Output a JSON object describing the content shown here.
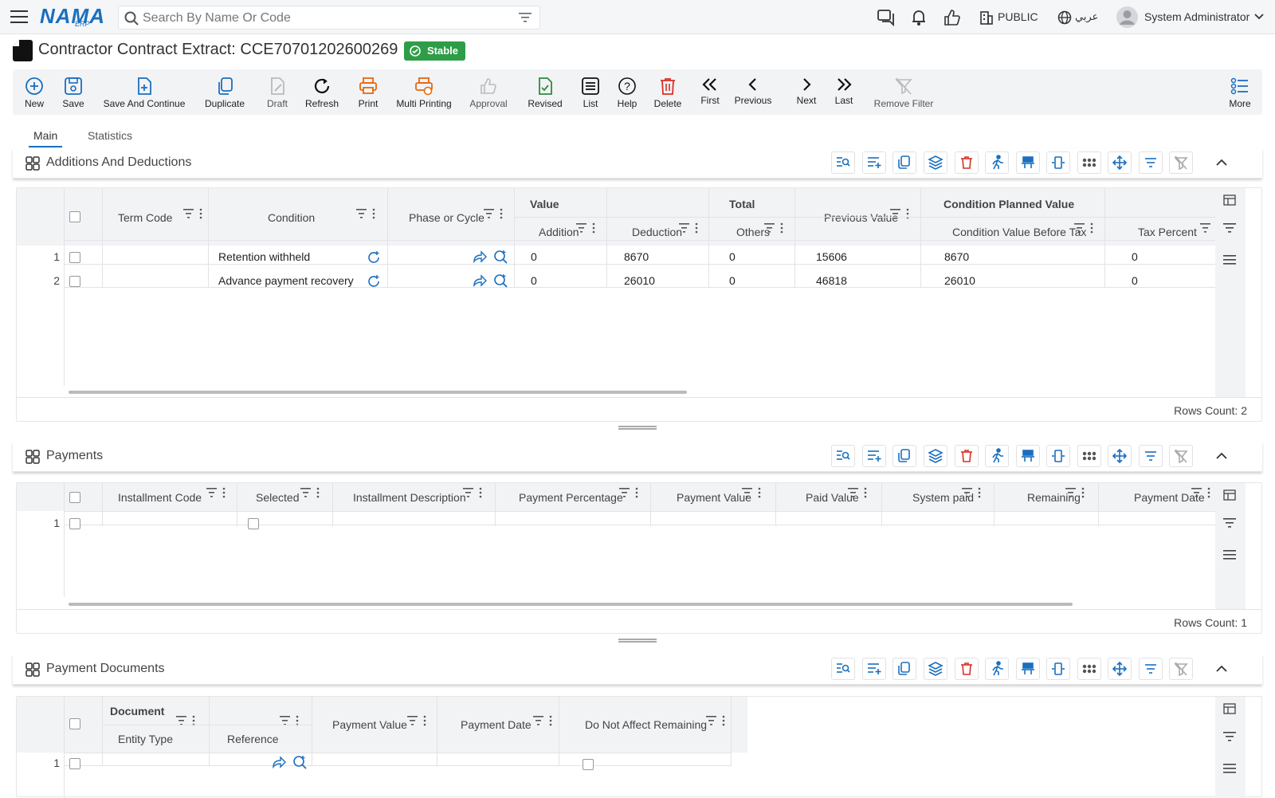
{
  "header": {
    "logo": "NAMA",
    "logo_sub": "ERP",
    "search_placeholder": "Search By Name Or Code",
    "public_label": "PUBLIC",
    "lang_label": "عربي",
    "user_name": "System Administrator"
  },
  "page": {
    "title": "Contractor Contract Extract: CCE70701202600269",
    "status": "Stable"
  },
  "toolbar": {
    "items": [
      "New",
      "Save",
      "Save And Continue",
      "Duplicate",
      "Draft",
      "Refresh",
      "Print",
      "Multi Printing",
      "Approval",
      "Revised",
      "List",
      "Help",
      "Delete",
      "First",
      "Previous",
      "Next",
      "Last",
      "Remove Filter"
    ],
    "more": "More"
  },
  "tabs": [
    "Main",
    "Statistics"
  ],
  "additions": {
    "title": "Additions And Deductions",
    "groups": {
      "value": "Value",
      "total": "Total",
      "planned": "Condition Planned Value"
    },
    "columns": [
      "Term Code",
      "Condition",
      "Phase or Cycle",
      "Addition",
      "Deduction",
      "Others",
      "Previous Value",
      "Condition Value Before Tax",
      "Tax Percent"
    ],
    "rows": [
      {
        "n": "1",
        "term_code": "",
        "condition": "Retention withheld",
        "phase": "",
        "addition": "0",
        "deduction": "8670",
        "others": "0",
        "previous": "15606",
        "before_tax": "8670",
        "tax": "0"
      },
      {
        "n": "2",
        "term_code": "",
        "condition": "Advance payment recovery",
        "phase": "",
        "addition": "0",
        "deduction": "26010",
        "others": "0",
        "previous": "46818",
        "before_tax": "26010",
        "tax": "0"
      }
    ],
    "rows_count": "Rows Count: 2"
  },
  "payments": {
    "title": "Payments",
    "columns": [
      "Installment Code",
      "Selected",
      "Installment Description",
      "Payment Percentage",
      "Payment Value",
      "Paid Value",
      "System paid",
      "Remaining",
      "Payment Date"
    ],
    "rows": [
      {
        "n": "1"
      }
    ],
    "rows_count": "Rows Count: 1"
  },
  "documents": {
    "title": "Payment Documents",
    "group": "Document",
    "columns": [
      "Entity Type",
      "Reference",
      "Payment Value",
      "Payment Date",
      "Do Not Affect Remaining"
    ],
    "rows": [
      {
        "n": "1"
      }
    ]
  },
  "colors": {
    "accent": "#1a6fbe",
    "success": "#2e9d48",
    "danger": "#d93025",
    "print": "#e8670c",
    "green": "#2e8b3d"
  }
}
